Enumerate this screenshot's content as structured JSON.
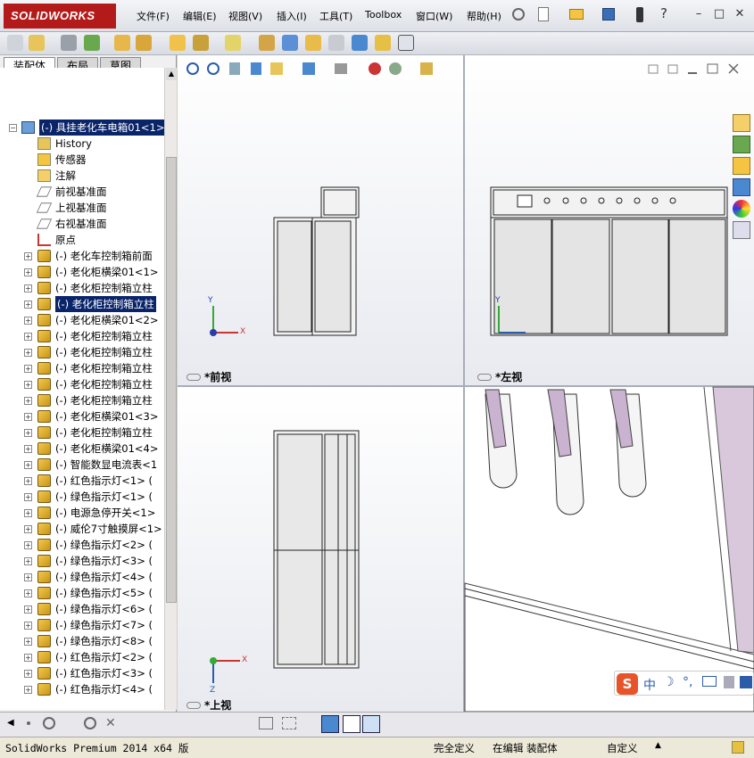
{
  "app": {
    "logo": "SOLIDWORKS"
  },
  "menu": [
    "文件(F)",
    "编辑(E)",
    "视图(V)",
    "插入(I)",
    "工具(T)",
    "Toolbox",
    "窗口(W)",
    "帮助(H)"
  ],
  "tabs": [
    "装配体",
    "布局",
    "草图"
  ],
  "tree": {
    "root": "(-) 具挂老化车电箱01<1>",
    "items": [
      {
        "label": "History",
        "type": "history"
      },
      {
        "label": "传感器",
        "type": "sensor"
      },
      {
        "label": "注解",
        "type": "annotation"
      },
      {
        "label": "前视基准面",
        "type": "plane"
      },
      {
        "label": "上视基准面",
        "type": "plane"
      },
      {
        "label": "右视基准面",
        "type": "plane"
      },
      {
        "label": "原点",
        "type": "origin"
      },
      {
        "label": "(-) 老化车控制箱前面",
        "type": "part"
      },
      {
        "label": "(-) 老化柜横梁01<1>",
        "type": "part"
      },
      {
        "label": "(-) 老化柜控制箱立柱",
        "type": "part"
      },
      {
        "label": "(-) 老化柜控制箱立柱",
        "type": "part",
        "selected": true
      },
      {
        "label": "(-) 老化柜横梁01<2>",
        "type": "part"
      },
      {
        "label": "(-) 老化柜控制箱立柱",
        "type": "part"
      },
      {
        "label": "(-) 老化柜控制箱立柱",
        "type": "part"
      },
      {
        "label": "(-) 老化柜控制箱立柱",
        "type": "part"
      },
      {
        "label": "(-) 老化柜控制箱立柱",
        "type": "part"
      },
      {
        "label": "(-) 老化柜控制箱立柱",
        "type": "part"
      },
      {
        "label": "(-) 老化柜横梁01<3>",
        "type": "part"
      },
      {
        "label": "(-) 老化柜控制箱立柱",
        "type": "part"
      },
      {
        "label": "(-) 老化柜横梁01<4>",
        "type": "part"
      },
      {
        "label": "(-) 智能数显电流表<1",
        "type": "part"
      },
      {
        "label": "(-) 红色指示灯<1> (",
        "type": "part"
      },
      {
        "label": "(-) 绿色指示灯<1> (",
        "type": "part"
      },
      {
        "label": "(-) 电源急停开关<1>",
        "type": "part"
      },
      {
        "label": "(-) 威伦7寸触摸屏<1>",
        "type": "part"
      },
      {
        "label": "(-) 绿色指示灯<2> (",
        "type": "part"
      },
      {
        "label": "(-) 绿色指示灯<3> (",
        "type": "part"
      },
      {
        "label": "(-) 绿色指示灯<4> (",
        "type": "part"
      },
      {
        "label": "(-) 绿色指示灯<5> (",
        "type": "part"
      },
      {
        "label": "(-) 绿色指示灯<6> (",
        "type": "part"
      },
      {
        "label": "(-) 绿色指示灯<7> (",
        "type": "part"
      },
      {
        "label": "(-) 绿色指示灯<8> (",
        "type": "part"
      },
      {
        "label": "(-) 红色指示灯<2> (",
        "type": "part"
      },
      {
        "label": "(-) 红色指示灯<3> (",
        "type": "part"
      },
      {
        "label": "(-) 红色指示灯<4> (",
        "type": "part"
      }
    ]
  },
  "viewports": {
    "front": "*前视",
    "left": "*左视",
    "top": "*上视",
    "axes": {
      "x": "X",
      "y": "Y",
      "z": "Z"
    }
  },
  "status": {
    "product": "SolidWorks Premium 2014 x64 版",
    "defined": "完全定义",
    "editing": "在编辑 装配体",
    "custom": "自定义"
  },
  "ime": {
    "lang": "中"
  }
}
